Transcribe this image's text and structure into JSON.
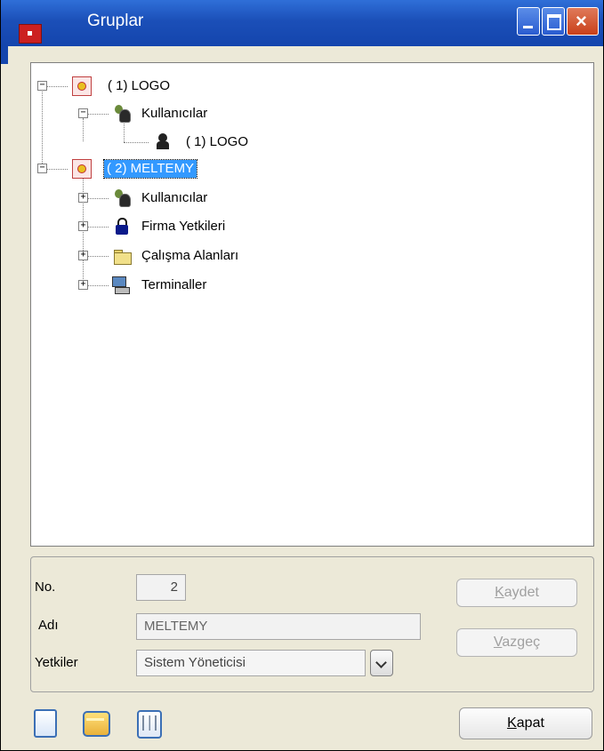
{
  "window": {
    "title": "Gruplar"
  },
  "tree": {
    "nodes": [
      {
        "label": "( 1) LOGO",
        "expander": "−",
        "icon": "group-icon"
      },
      {
        "label": "Kullanıcılar",
        "expander": "−",
        "icon": "users-icon"
      },
      {
        "label": "( 1) LOGO",
        "expander": "",
        "icon": "user-icon"
      },
      {
        "label": "( 2) MELTEMY",
        "expander": "−",
        "icon": "group-icon",
        "selected": true
      },
      {
        "label": "Kullanıcılar",
        "expander": "+",
        "icon": "users-icon"
      },
      {
        "label": "Firma Yetkileri",
        "expander": "+",
        "icon": "lock-icon"
      },
      {
        "label": "Çalışma Alanları",
        "expander": "+",
        "icon": "folder-icon"
      },
      {
        "label": "Terminaller",
        "expander": "+",
        "icon": "terminal-icon"
      }
    ]
  },
  "form": {
    "no_label": "No.",
    "no_value": "2",
    "name_label": "Adı",
    "name_value": "MELTEMY",
    "perm_label": "Yetkiler",
    "perm_value": "Sistem Yöneticisi",
    "save_hotkey": "K",
    "save_rest": "aydet",
    "cancel_hotkey": "V",
    "cancel_rest": "azgeç"
  },
  "footer": {
    "close_hotkey": "K",
    "close_rest": "apat"
  }
}
